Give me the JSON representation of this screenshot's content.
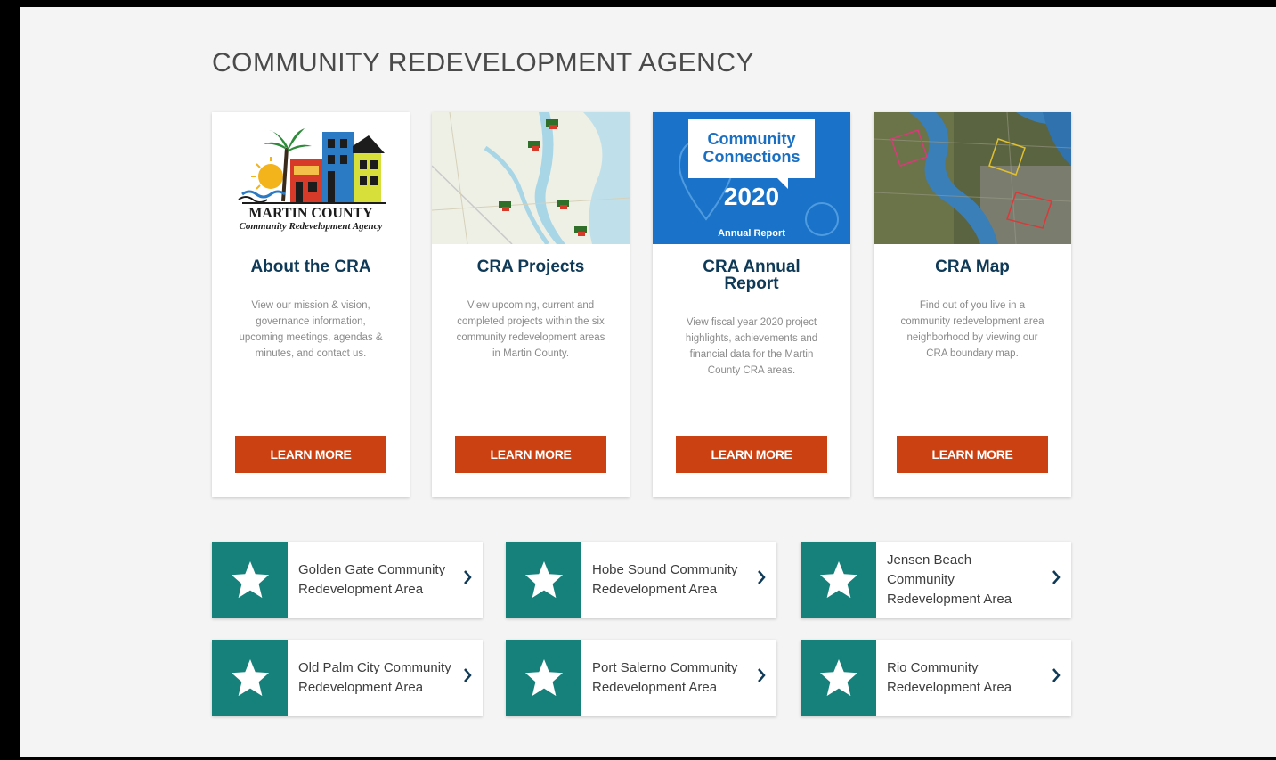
{
  "header": {
    "title": "COMMUNITY REDEVELOPMENT AGENCY"
  },
  "cards": [
    {
      "title": "About the CRA",
      "description": "View our mission & vision, governance information, upcoming meetings, agendas & minutes, and contact us.",
      "button": "LEARN MORE",
      "logo": {
        "line1": "MARTIN COUNTY",
        "line2": "Community Redevelopment Agency"
      }
    },
    {
      "title": "CRA Projects",
      "description": "View upcoming, current and completed projects within the six community redevelopment areas in Martin County.",
      "button": "LEARN MORE"
    },
    {
      "title": "CRA Annual Report",
      "description": "View fiscal year 2020 project highlights, achievements and financial data for the Martin County CRA areas.",
      "button": "LEARN MORE",
      "graphic": {
        "bubble": "Community Connections",
        "year": "2020",
        "subtitle": "Annual Report"
      }
    },
    {
      "title": "CRA Map",
      "description": "Find out of you live in a community redevelopment area neighborhood by viewing our CRA boundary map.",
      "button": "LEARN MORE"
    }
  ],
  "areas": [
    {
      "label": "Golden Gate Community Redevelopment Area",
      "icon": "star-icon"
    },
    {
      "label": "Hobe Sound Community Redevelopment Area",
      "icon": "star-icon"
    },
    {
      "label": "Jensen Beach Community Redevelopment Area",
      "icon": "star-icon"
    },
    {
      "label": "Old Palm City Community Redevelopment Area",
      "icon": "star-icon"
    },
    {
      "label": "Port Salerno Community Redevelopment Area",
      "icon": "star-icon"
    },
    {
      "label": "Rio Community Redevelopment Area",
      "icon": "star-icon"
    }
  ],
  "colors": {
    "button": "#cc4111",
    "teal": "#16807a",
    "title": "#0f3a57",
    "report_blue": "#1a73c8"
  }
}
